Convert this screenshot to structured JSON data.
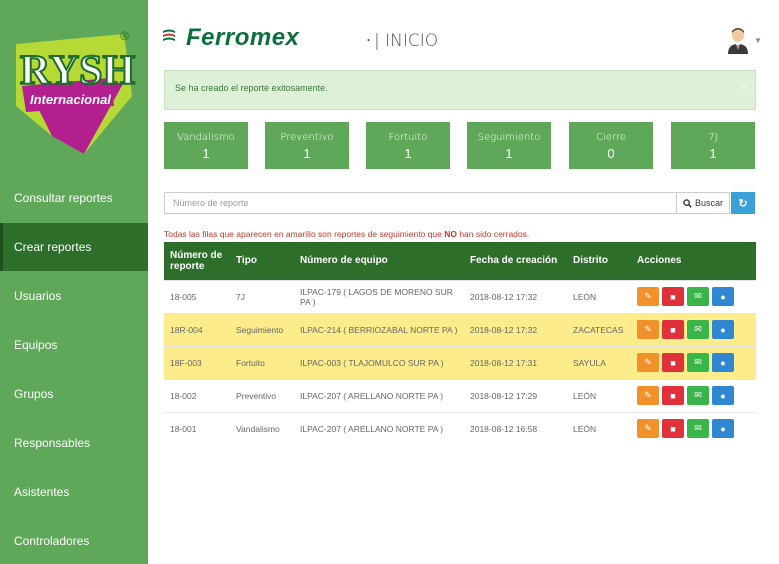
{
  "sidebar": {
    "logo_text": "RYSH",
    "logo_subtext": "Internacional",
    "logo_mark": "®",
    "items": [
      {
        "label": "Consultar reportes"
      },
      {
        "label": "Crear reportes"
      },
      {
        "label": "Usuarios"
      },
      {
        "label": "Equipos"
      },
      {
        "label": "Grupos"
      },
      {
        "label": "Responsables"
      },
      {
        "label": "Asistentes"
      },
      {
        "label": "Controladores"
      }
    ]
  },
  "header": {
    "brand": "Ferromex",
    "brand_dot": ".",
    "title": "| INICIO"
  },
  "alert": {
    "text": "Se ha creado el reporte exitosamente.",
    "close": "×"
  },
  "stats": [
    {
      "label": "Vandalismo",
      "value": "1"
    },
    {
      "label": "Preventivo",
      "value": "1"
    },
    {
      "label": "Fortuito",
      "value": "1"
    },
    {
      "label": "Seguimiento",
      "value": "1"
    },
    {
      "label": "Cierre",
      "value": "0"
    },
    {
      "label": "7J",
      "value": "1"
    }
  ],
  "search": {
    "placeholder": "Número de reporte",
    "button": "Buscar"
  },
  "notice": {
    "before": "Todas las filas que aparecen en amarillo son reportes de seguimiento que ",
    "bold": "NO",
    "after": " han sido cerrados."
  },
  "table": {
    "headers": [
      "Número de reporte",
      "Tipo",
      "Número de equipo",
      "Fecha de creación",
      "Distrito",
      "Acciones"
    ],
    "rows": [
      {
        "num": "18-005",
        "tipo": "7J",
        "equipo": "ILPAC-179 ( LAGOS DE MORENO SUR PA )",
        "fecha": "2018-08-12 17:32",
        "distrito": "LEÓN",
        "highlight": false
      },
      {
        "num": "18R-004",
        "tipo": "Seguimiento",
        "equipo": "ILPAC-214 ( BERRIOZABAL NORTE PA )",
        "fecha": "2018-08-12 17:32",
        "distrito": "ZACATECAS",
        "highlight": true
      },
      {
        "num": "18F-003",
        "tipo": "Fortuito",
        "equipo": "ILPAC-003 ( TLAJOMULCO SUR PA )",
        "fecha": "2018-08-12 17:31",
        "distrito": "SAYULA",
        "highlight": true
      },
      {
        "num": "18-002",
        "tipo": "Preventivo",
        "equipo": "ILPAC-207 ( ARELLANO NORTE PA )",
        "fecha": "2018-08-12 17:29",
        "distrito": "LEÓN",
        "highlight": false
      },
      {
        "num": "18-001",
        "tipo": "Vandalismo",
        "equipo": "ILPAC-207 ( ARELLANO NORTE PA )",
        "fecha": "2018-08-12 16:58",
        "distrito": "LEÓN",
        "highlight": false
      }
    ]
  },
  "colors": {
    "sidebar": "#5fa85a",
    "active": "#2d6e2a",
    "highlight": "#fcec8b"
  }
}
